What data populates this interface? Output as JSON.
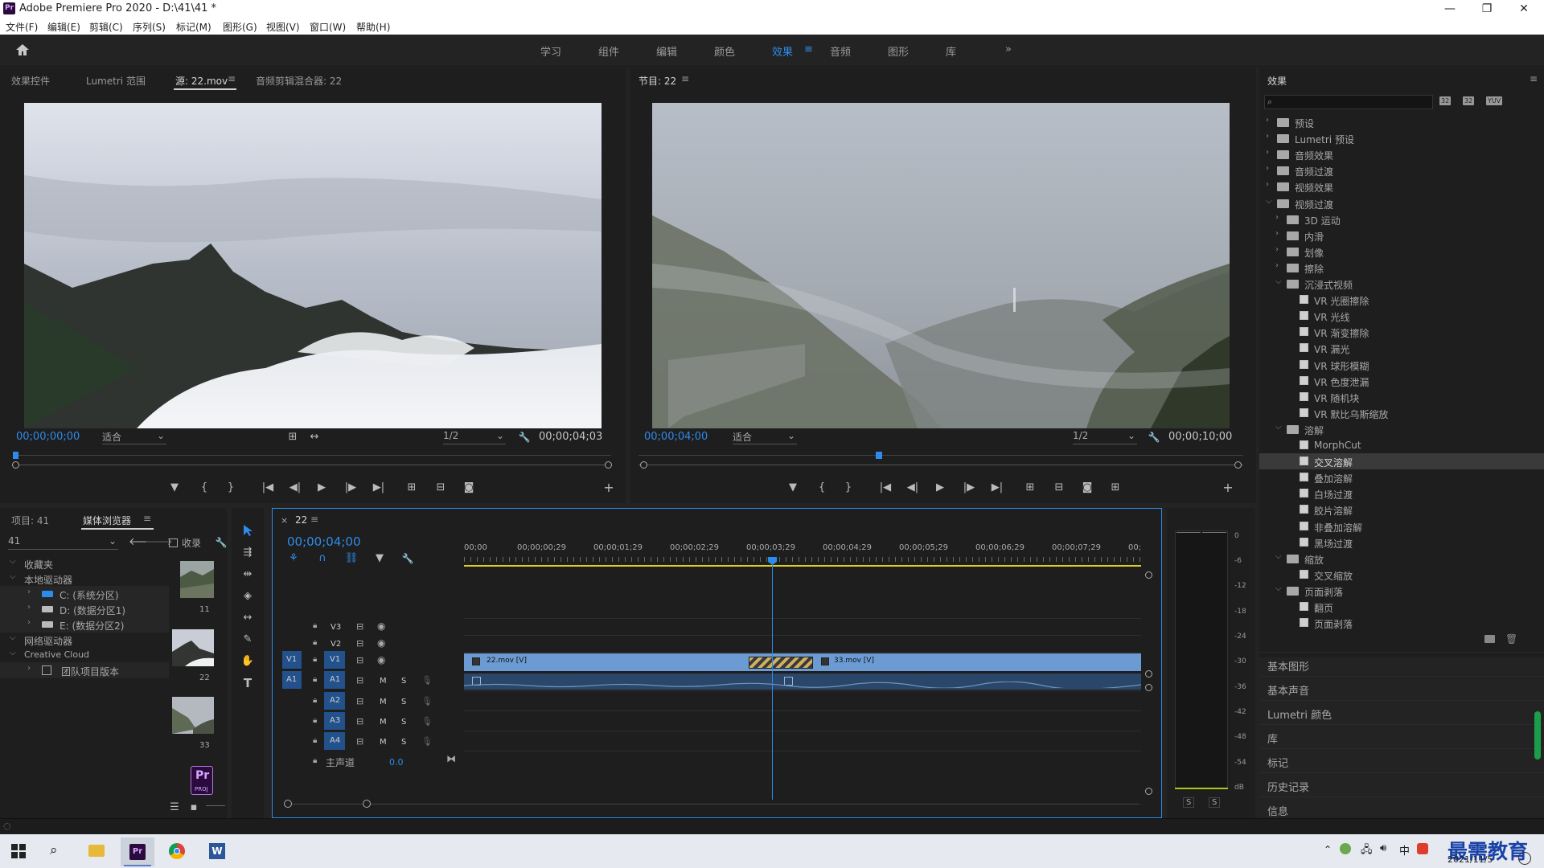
{
  "window": {
    "title": "Adobe Premiere Pro 2020 - D:\\41\\41 *",
    "logo_text": "Pr",
    "minimize": "—",
    "maximize": "❐",
    "close": "✕"
  },
  "menu": [
    "文件(F)",
    "编辑(E)",
    "剪辑(C)",
    "序列(S)",
    "标记(M)",
    "图形(G)",
    "视图(V)",
    "窗口(W)",
    "帮助(H)"
  ],
  "workspaces": [
    "学习",
    "组件",
    "编辑",
    "颜色",
    "效果",
    "音频",
    "图形",
    "库"
  ],
  "workspace_active": "效果",
  "workspace_menu_glyph": "≡",
  "workspace_more_glyph": "»",
  "source_panel": {
    "tabs": [
      "效果控件",
      "Lumetri 范围",
      "源: 22.mov",
      "音频剪辑混合器: 22"
    ],
    "active_tab": "源: 22.mov",
    "timecode": "00;00;00;00",
    "fit": "适合",
    "resolution": "1/2",
    "duration": "00;00;04;03"
  },
  "program_panel": {
    "title": "节目: 22",
    "timecode": "00;00;04;00",
    "fit": "适合",
    "resolution": "1/2",
    "duration": "00;00;10;00"
  },
  "transport_glyphs": {
    "marker": "▼",
    "mark_in": "{",
    "mark_out": "}",
    "go_in": "|◀",
    "step_back": "◀|",
    "play": "▶",
    "step_fwd": "|▶",
    "go_out": "▶|",
    "insert": "⊞",
    "overwrite": "⊟",
    "camera": "◙",
    "add": "+",
    "wrench": "🔧",
    "settings": "⊞"
  },
  "project_panel": {
    "tabs": [
      "项目: 41",
      "媒体浏览器"
    ],
    "active_tab": "媒体浏览器",
    "path": "41",
    "ingest_label": "收录",
    "tree": [
      {
        "label": "收藏夹",
        "level": 0,
        "expanded": true
      },
      {
        "label": "本地驱动器",
        "level": 0,
        "expanded": true
      },
      {
        "label": "C: (系统分区)",
        "level": 1
      },
      {
        "label": "D: (数据分区1)",
        "level": 1
      },
      {
        "label": "E: (数据分区2)",
        "level": 1
      },
      {
        "label": "网络驱动器",
        "level": 0,
        "expanded": true
      },
      {
        "label": "Creative Cloud",
        "level": 0,
        "expanded": true
      },
      {
        "label": "团队项目版本",
        "level": 1
      }
    ],
    "thumbs": [
      {
        "label": "11"
      },
      {
        "label": "22"
      },
      {
        "label": "33"
      },
      {
        "label": "PROJ",
        "icon": "Pr"
      }
    ]
  },
  "timeline": {
    "sequence_name": "22",
    "timecode": "00;00;04;00",
    "ruler": [
      "00;00",
      "00;00;00;29",
      "00;00;01;29",
      "00;00;02;29",
      "00;00;03;29",
      "00;00;04;29",
      "00;00;05;29",
      "00;00;06;29",
      "00;00;07;29",
      "00;"
    ],
    "video_tracks": [
      {
        "name": "V3",
        "source": ""
      },
      {
        "name": "V2",
        "source": ""
      },
      {
        "name": "V1",
        "source": "V1"
      }
    ],
    "audio_tracks": [
      {
        "name": "A1",
        "source": "A1",
        "m": "M",
        "s": "S"
      },
      {
        "name": "A2",
        "source": "",
        "m": "M",
        "s": "S"
      },
      {
        "name": "A3",
        "source": "",
        "m": "M",
        "s": "S"
      },
      {
        "name": "A4",
        "source": "",
        "m": "M",
        "s": "S"
      }
    ],
    "master": {
      "label": "主声道",
      "value": "0.0"
    },
    "clips": [
      {
        "label": "22.mov [V]",
        "track": "V1"
      },
      {
        "label": "33.mov [V]",
        "track": "V1"
      }
    ]
  },
  "meter": {
    "scale": [
      "0",
      "-6",
      "-12",
      "-18",
      "-24",
      "-30",
      "-36",
      "-42",
      "-48",
      "-54",
      "dB"
    ],
    "solo": [
      "S",
      "S"
    ]
  },
  "effects_panel": {
    "title": "效果",
    "menu_glyph": "≡",
    "search_placeholder": "",
    "filter_icons": [
      "32",
      "32",
      "YUV"
    ],
    "tree": [
      {
        "label": "预设",
        "type": "folder",
        "level": 0,
        "expanded": false
      },
      {
        "label": "Lumetri 预设",
        "type": "folder",
        "level": 0,
        "expanded": false
      },
      {
        "label": "音频效果",
        "type": "folder",
        "level": 0,
        "expanded": false
      },
      {
        "label": "音频过渡",
        "type": "folder",
        "level": 0,
        "expanded": false
      },
      {
        "label": "视频效果",
        "type": "folder",
        "level": 0,
        "expanded": false
      },
      {
        "label": "视频过渡",
        "type": "folder",
        "level": 0,
        "expanded": true
      },
      {
        "label": "3D 运动",
        "type": "folder",
        "level": 1,
        "expanded": false
      },
      {
        "label": "内滑",
        "type": "folder",
        "level": 1,
        "expanded": false
      },
      {
        "label": "划像",
        "type": "folder",
        "level": 1,
        "expanded": false
      },
      {
        "label": "擦除",
        "type": "folder",
        "level": 1,
        "expanded": false
      },
      {
        "label": "沉浸式视频",
        "type": "folder",
        "level": 1,
        "expanded": true
      },
      {
        "label": "VR 光圈擦除",
        "type": "fx",
        "level": 2
      },
      {
        "label": "VR 光线",
        "type": "fx",
        "level": 2
      },
      {
        "label": "VR 渐变擦除",
        "type": "fx",
        "level": 2
      },
      {
        "label": "VR 漏光",
        "type": "fx",
        "level": 2
      },
      {
        "label": "VR 球形模糊",
        "type": "fx",
        "level": 2
      },
      {
        "label": "VR 色度泄漏",
        "type": "fx",
        "level": 2
      },
      {
        "label": "VR 随机块",
        "type": "fx",
        "level": 2
      },
      {
        "label": "VR 默比乌斯缩放",
        "type": "fx",
        "level": 2
      },
      {
        "label": "溶解",
        "type": "folder",
        "level": 1,
        "expanded": true
      },
      {
        "label": "MorphCut",
        "type": "fx",
        "level": 2
      },
      {
        "label": "交叉溶解",
        "type": "fx",
        "level": 2,
        "selected": true
      },
      {
        "label": "叠加溶解",
        "type": "fx",
        "level": 2
      },
      {
        "label": "白场过渡",
        "type": "fx",
        "level": 2
      },
      {
        "label": "胶片溶解",
        "type": "fx",
        "level": 2
      },
      {
        "label": "非叠加溶解",
        "type": "fx",
        "level": 2
      },
      {
        "label": "黑场过渡",
        "type": "fx",
        "level": 2
      },
      {
        "label": "缩放",
        "type": "folder",
        "level": 1,
        "expanded": true
      },
      {
        "label": "交叉缩放",
        "type": "fx",
        "level": 2
      },
      {
        "label": "页面剥落",
        "type": "folder",
        "level": 1,
        "expanded": true
      },
      {
        "label": "翻页",
        "type": "fx",
        "level": 2
      },
      {
        "label": "页面剥落",
        "type": "fx",
        "level": 2
      }
    ],
    "sections": [
      "基本图形",
      "基本声音",
      "Lumetri 颜色",
      "库",
      "标记",
      "历史记录",
      "信息"
    ]
  },
  "taskbar": {
    "date": "2021/11/5",
    "ime": "中",
    "watermark": "最需教育"
  },
  "colors": {
    "accent": "#2d8ceb",
    "panel_bg": "#1e1e1e",
    "clip_blue": "#6b9bd2",
    "audio_clip": "#2a4668",
    "playhead": "#2d8ceb"
  }
}
